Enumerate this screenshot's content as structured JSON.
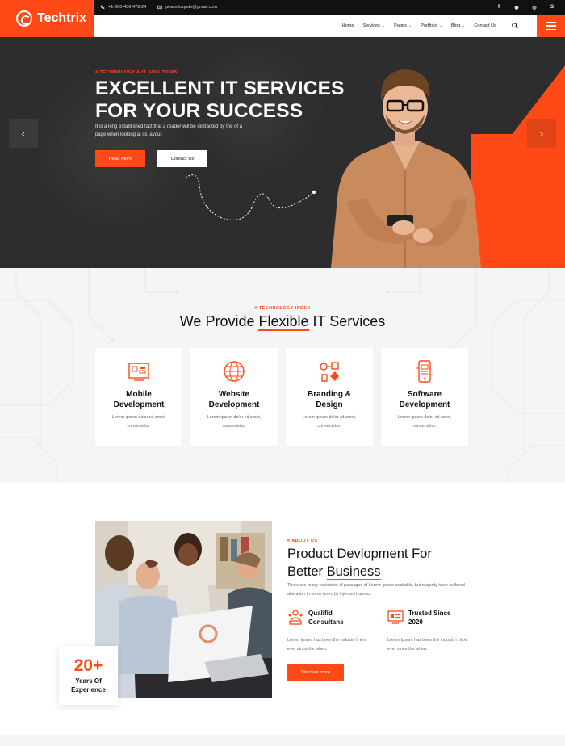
{
  "brand": {
    "name": "Techtrix",
    "accent": "#ff4a17",
    "dark": "#111111"
  },
  "topbar": {
    "phone": "+1-800-456-478-24",
    "email": "peacefulqode@gmail.com",
    "socials": [
      "facebook-icon",
      "github-icon",
      "instagram-icon",
      "skype-icon"
    ]
  },
  "nav": {
    "items": [
      {
        "label": "Home",
        "dropdown": false
      },
      {
        "label": "Services",
        "dropdown": true
      },
      {
        "label": "Pages",
        "dropdown": true
      },
      {
        "label": "Portfolio",
        "dropdown": true
      },
      {
        "label": "Blog",
        "dropdown": true
      },
      {
        "label": "Contact Us",
        "dropdown": false
      }
    ]
  },
  "hero": {
    "tag": "# TECHNOLOGY & IT SOLUTIONS",
    "title_line1": "EXCELLENT IT SERVICES",
    "title_line2": "FOR YOUR SUCCESS",
    "description": "It is a long established fact that a reader will be distracted by the of a page when looking at its layout.",
    "primary_button": "Read More",
    "secondary_button": "Contact Us",
    "prev_arrow": "‹",
    "next_arrow": "›"
  },
  "services": {
    "tag": "# TECHNOLOGY INDEX",
    "title_before": "We Provide ",
    "title_highlight": "Flexible",
    "title_after": " IT Services",
    "cards": [
      {
        "title": "Mobile Development",
        "text": "Lorem ipsum dolor sit amet, consectetur.",
        "icon": "mobile-dev-icon"
      },
      {
        "title": "Website Development",
        "text": "Lorem ipsum dolor sit amet, consectetur.",
        "icon": "globe-icon"
      },
      {
        "title": "Branding & Design",
        "text": "Lorem ipsum dolor sit amet, consectetur.",
        "icon": "branding-icon"
      },
      {
        "title": "Software Development",
        "text": "Lorem ipsum dolor sit amet, consectetur.",
        "icon": "software-icon"
      }
    ]
  },
  "about": {
    "tag": "# ABOUT US",
    "title_line1": "Product Devlopment For",
    "title_line2_before": "Better ",
    "title_line2_highlight": "Business",
    "description": "There are many variations of passages of Lorem Ipsum available, but majority have suffered alteration in some form, by injected humour.",
    "features": [
      {
        "title": "Qualifid Consultans",
        "text": "Lorem Ipsum has been the industry's text ever since the when.",
        "icon": "consultants-icon"
      },
      {
        "title": "Trusted Since 2020",
        "text": "Lorem Ipsum has been the industry's text ever since the when.",
        "icon": "trusted-icon"
      }
    ],
    "button": "Discover more",
    "experience_number": "20+",
    "experience_label": "Years Of Experience"
  }
}
